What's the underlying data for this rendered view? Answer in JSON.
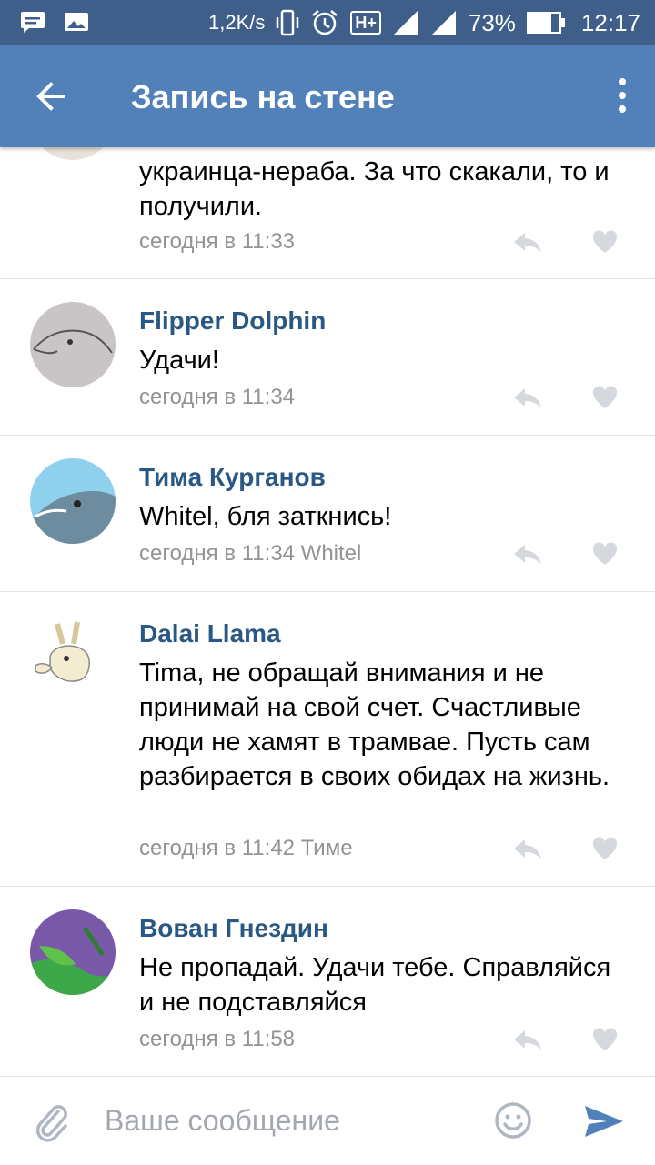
{
  "status_bar": {
    "speed": "1,2K/s",
    "network": "H+",
    "battery_percent": "73%",
    "battery_level": 0.73,
    "time": "12:17"
  },
  "app_bar": {
    "title": "Запись на стене"
  },
  "comments": [
    {
      "name": "",
      "text": "украинца-нераба. За что скакали, то и получили.",
      "meta": "сегодня в 11:33"
    },
    {
      "name": "Flipper Dolphin",
      "text": "Удачи!",
      "meta": "сегодня в 11:34"
    },
    {
      "name": "Тима Курганов",
      "text": "Whitel, бля заткнись!",
      "meta": "сегодня в 11:34 Whitel"
    },
    {
      "name": "Dalai Llama",
      "text": "Tima, не обращай внимания и не принимай на свой счет. Счастливые люди не хамят в трамвае. Пусть сам разбирается в своих обидах на жизнь.",
      "meta": "сегодня в 11:42 Тиме"
    },
    {
      "name": "Вован Гнездин",
      "text": "Не пропадай. Удачи тебе. Справляйся и не подставляйся",
      "meta": "сегодня в 11:58"
    }
  ],
  "composer": {
    "placeholder": "Ваше сообщение"
  },
  "colors": {
    "appbar": "#5181b8",
    "statusbar": "#3f5f8a",
    "name_link": "#2a5885",
    "meta": "#939393"
  },
  "icons": [
    "message-icon",
    "gallery-icon",
    "vibrate-icon",
    "alarm-icon",
    "signal-icon",
    "battery-icon",
    "back-arrow-icon",
    "more-vert-icon",
    "reply-icon",
    "heart-icon",
    "paperclip-icon",
    "emoji-icon",
    "send-icon"
  ]
}
